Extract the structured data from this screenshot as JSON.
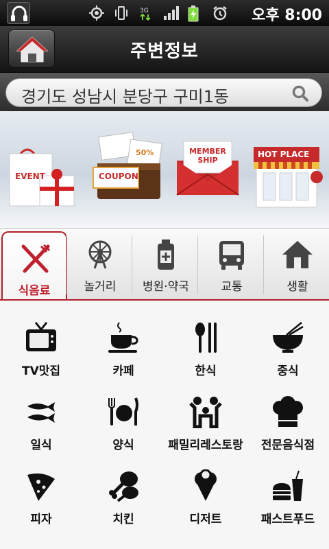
{
  "status_bar": {
    "time": "오후 8:00"
  },
  "header": {
    "title": "주변정보"
  },
  "location": {
    "text": "경기도 성남시 분당구 구미1동"
  },
  "banner": {
    "promos": [
      {
        "label": "EVENT"
      },
      {
        "label": "COUPON"
      },
      {
        "label": "MEMBER SHIP"
      },
      {
        "label": "HOT PLACE"
      }
    ]
  },
  "tabs": [
    {
      "label": "식음료",
      "icon": "fork-knife-icon",
      "active": true
    },
    {
      "label": "놀거리",
      "icon": "ferris-wheel-icon"
    },
    {
      "label": "병원·약국",
      "icon": "medicine-bottle-icon"
    },
    {
      "label": "교통",
      "icon": "bus-icon"
    },
    {
      "label": "생활",
      "icon": "house-icon"
    }
  ],
  "categories": [
    {
      "label": "TV맛집",
      "icon": "tv-icon"
    },
    {
      "label": "카페",
      "icon": "coffee-cup-icon"
    },
    {
      "label": "한식",
      "icon": "spoon-chopsticks-icon"
    },
    {
      "label": "중식",
      "icon": "noodle-bowl-icon"
    },
    {
      "label": "일식",
      "icon": "fish-icon"
    },
    {
      "label": "양식",
      "icon": "plate-fork-knife-icon"
    },
    {
      "label": "패밀리레스토랑",
      "icon": "family-icon"
    },
    {
      "label": "전문음식점",
      "icon": "chef-hat-icon"
    },
    {
      "label": "피자",
      "icon": "pizza-icon"
    },
    {
      "label": "치킨",
      "icon": "chicken-leg-icon"
    },
    {
      "label": "디저트",
      "icon": "ice-cream-icon"
    },
    {
      "label": "패스트푸드",
      "icon": "burger-drink-icon"
    }
  ]
}
